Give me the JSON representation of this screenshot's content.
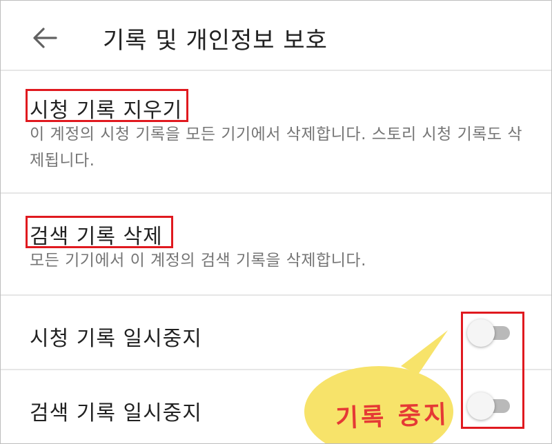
{
  "header": {
    "back_icon": "arrow-left-icon",
    "title": "기록 및 개인정보 보호"
  },
  "items": [
    {
      "title": "시청 기록 지우기",
      "description": "이 계정의 시청 기록을 모든 기기에서 삭제합니다. 스토리 시청 기록도 삭제됩니다."
    },
    {
      "title": "검색 기록 삭제",
      "description": "모든 기기에서 이 계정의 검색 기록을 삭제합니다."
    },
    {
      "title": "시청 기록 일시중지",
      "toggle_on": false
    },
    {
      "title": "검색 기록 일시중지",
      "toggle_on": false
    }
  ],
  "annotation": {
    "callout_text": "기록 중지",
    "callout_color": "#f7e36a",
    "highlight_color": "#e0191f"
  }
}
